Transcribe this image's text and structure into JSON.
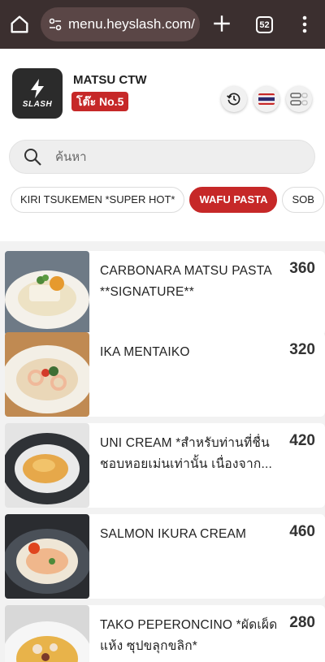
{
  "browser": {
    "url": "menu.heyslash.com/",
    "tab_count": "52",
    "icons": [
      "home-icon",
      "site-settings-icon",
      "plus-icon",
      "tab-switcher-icon",
      "more-vertical-icon"
    ]
  },
  "store": {
    "logo_text": "SLASH",
    "name": "MATSU CTW",
    "table_label": "โต๊ะ No.5",
    "accent_color": "#c62828"
  },
  "header_buttons": [
    "history-icon",
    "thai-flag-icon",
    "layout-toggle-icon"
  ],
  "search": {
    "placeholder": "ค้นหา"
  },
  "categories": [
    {
      "label": "KIRI TSUKEMEN *SUPER HOT*",
      "active": false
    },
    {
      "label": "WAFU PASTA",
      "active": true
    },
    {
      "label": "SOB",
      "active": false
    }
  ],
  "menu_items": [
    {
      "name": "CARBONARA MATSU PASTA **SIGNATURE**",
      "price": "360"
    },
    {
      "name": "IKA MENTAIKO",
      "price": "320"
    },
    {
      "name": "UNI CREAM *สำหรับท่านที่ชื่นชอบหอยเม่นเท่านั้น เนื่องจาก...",
      "price": "420"
    },
    {
      "name": "SALMON IKURA CREAM",
      "price": "460"
    },
    {
      "name": "TAKO PEPERONCINO *ผัดเผ็ดแห้ง ซุปขลุกขลิก*",
      "price": "280"
    }
  ]
}
